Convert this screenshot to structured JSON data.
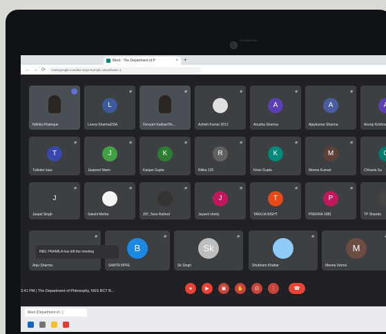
{
  "laptop": {
    "camera_label": "HD WEBCAM"
  },
  "browser": {
    "tab_title": "Meet - The Department of P",
    "tab_close": "×",
    "new_tab": "+",
    "url": "meet.google.com/abc-wxyz-kue?pli=1&authuser=1"
  },
  "participants": [
    {
      "name": "Nikhila Khaleque",
      "initial": "",
      "color": "#1a73e8",
      "video": true,
      "speaking": true
    },
    {
      "name": "Leena SharmaDSA",
      "initial": "L",
      "color": "#3c5a99",
      "video": false
    },
    {
      "name": "Devyani Kakkar/Sh...",
      "initial": "",
      "color": "#000",
      "video": true
    },
    {
      "name": "Ashish Kumar 3012",
      "initial": "",
      "color": "#e0e0e0",
      "video": false,
      "photo": true
    },
    {
      "name": "Anusha Sharma",
      "initial": "A",
      "color": "#5c3fb4",
      "video": false
    },
    {
      "name": "Ajaykumar Sharma",
      "initial": "A",
      "color": "#4a5d9e",
      "video": false
    },
    {
      "name": "Anoop Krishna",
      "initial": "A",
      "color": "#5c3fb4",
      "video": false
    },
    {
      "name": "Tulinder kaur",
      "initial": "T",
      "color": "#3949ab",
      "video": false
    },
    {
      "name": "Jaspreet Mann",
      "initial": "J",
      "color": "#43a047",
      "video": false
    },
    {
      "name": "Kanjan Gupta",
      "initial": "K",
      "color": "#2e7d32",
      "video": false
    },
    {
      "name": "Ritika 125",
      "initial": "R",
      "color": "#616161",
      "video": false
    },
    {
      "name": "Kiran Gupta",
      "initial": "K",
      "color": "#00897b",
      "video": false
    },
    {
      "name": "Meena Kumari",
      "initial": "M",
      "color": "#5d4037",
      "video": false
    },
    {
      "name": "Chhavia Sa",
      "initial": "C",
      "color": "#00796b",
      "video": false
    },
    {
      "name": "Jaspal Singh",
      "initial": "J",
      "color": "#3c4043",
      "video": false
    },
    {
      "name": "Sakshi Mehta",
      "initial": "",
      "color": "#f5f5f5",
      "video": false,
      "photo": true
    },
    {
      "name": "ZIP_Tanu Rathod",
      "initial": "",
      "color": "#333",
      "video": false,
      "photo": true
    },
    {
      "name": "Jayanti shetty",
      "initial": "J",
      "color": "#c2185b",
      "video": false
    },
    {
      "name": "TANUJA BISHT",
      "initial": "T",
      "color": "#e64a19",
      "video": false
    },
    {
      "name": "PRERNA 1881",
      "initial": "P",
      "color": "#c2185b",
      "video": false
    },
    {
      "name": "TP Shandu",
      "initial": "",
      "color": "#444",
      "video": false,
      "photo": true
    },
    {
      "name": "Anju Sharma",
      "initial": "",
      "color": "#3c4043",
      "video": false
    },
    {
      "name": "SAMTA 5PRE",
      "initial": "B",
      "color": "#1e88e5",
      "video": false
    },
    {
      "name": "Sk Singh",
      "initial": "Sk",
      "color": "#bdbdbd",
      "video": false
    },
    {
      "name": "Shubham Khattar",
      "initial": "",
      "color": "#90caf9",
      "video": false,
      "photo": true
    },
    {
      "name": "Meena Verma",
      "initial": "M",
      "color": "#6d4c41",
      "video": false
    }
  ],
  "toast": "INEL PRAMILA has left the meeting",
  "meeting": {
    "time": "3:41 PM",
    "separator": "|",
    "title": "The Department of Philosophy, NSS BCT B..."
  },
  "controls": [
    {
      "name": "mic",
      "glyph": "●",
      "color": "#ea4335"
    },
    {
      "name": "camera",
      "glyph": "▶",
      "color": "#ea4335"
    },
    {
      "name": "captions",
      "glyph": "▣",
      "color": "#ea4335"
    },
    {
      "name": "raise-hand",
      "glyph": "✋",
      "color": "#ea4335"
    },
    {
      "name": "present",
      "glyph": "⊡",
      "color": "#ea4335"
    },
    {
      "name": "more",
      "glyph": "⋮",
      "color": "#ea4335"
    },
    {
      "name": "leave",
      "glyph": "☎",
      "color": "#ea4335"
    }
  ],
  "taskbar": {
    "item": "Meet (Department of...)"
  }
}
